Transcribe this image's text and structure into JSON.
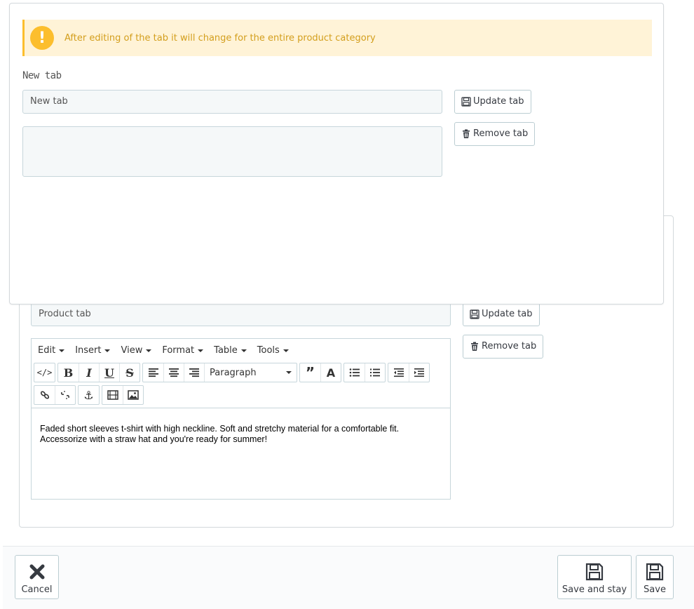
{
  "front_panel": {
    "alert_text": "After editing of the tab it will change for the entire product category",
    "alert_icon": "exclamation-icon",
    "label": "New tab",
    "title_input_value": "New tab",
    "update_button": "Update tab",
    "remove_button": "Remove tab"
  },
  "back_panel": {
    "title_input_value": "Product tab",
    "update_button": "Update tab",
    "remove_button": "Remove tab",
    "editor": {
      "menus": [
        "Edit",
        "Insert",
        "View",
        "Format",
        "Table",
        "Tools"
      ],
      "format_select": "Paragraph",
      "content": "Faded short sleeves t-shirt with high neckline. Soft and stretchy material for a comfortable fit. Accessorize with a straw hat and you're ready for summer!"
    }
  },
  "footer": {
    "cancel": "Cancel",
    "save_and_stay": "Save and stay",
    "save": "Save"
  },
  "colors": {
    "alert_bg": "#fff3d7",
    "alert_accent": "#fcbe2d",
    "alert_text": "#d39e1c",
    "input_bg": "#f5f8f9",
    "border": "#bbcdd2"
  }
}
